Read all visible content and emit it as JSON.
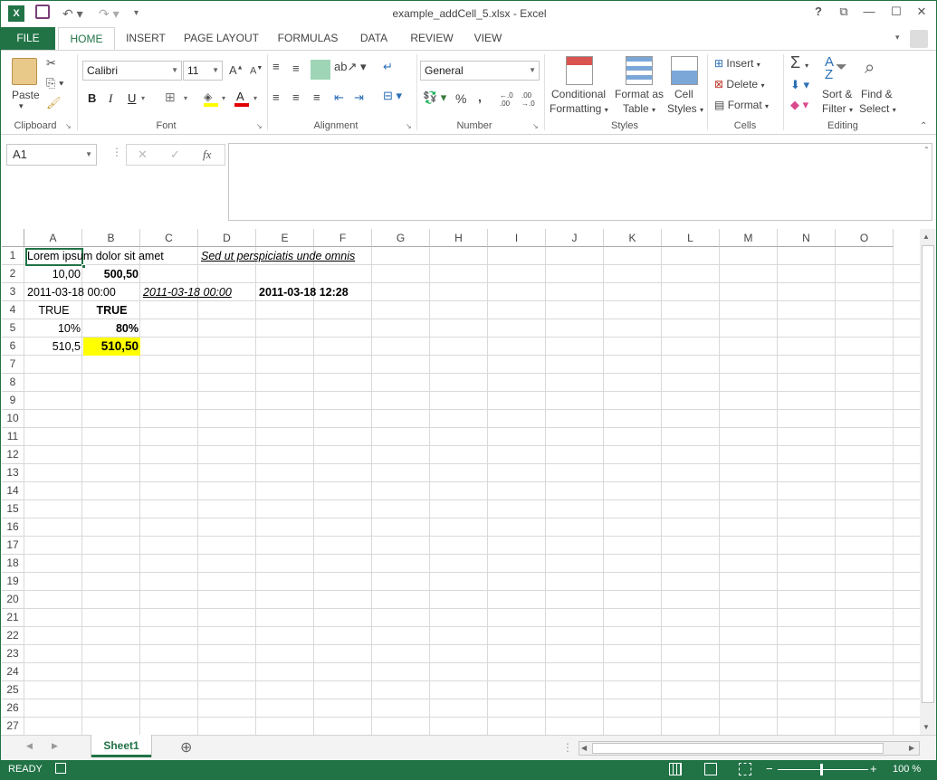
{
  "window": {
    "title": "example_addCell_5.xlsx - Excel",
    "help": "?",
    "restore_ribbon": "⧉",
    "minimize": "—",
    "maximize": "☐",
    "close": "✕"
  },
  "qat": {
    "excel_icon": "excel-logo-icon",
    "save": "save-icon",
    "undo": "undo-icon",
    "redo": "redo-icon",
    "customize": "customize-icon"
  },
  "tabs": [
    "FILE",
    "HOME",
    "INSERT",
    "PAGE LAYOUT",
    "FORMULAS",
    "DATA",
    "REVIEW",
    "VIEW"
  ],
  "ribbon": {
    "clipboard": {
      "label": "Clipboard",
      "paste": "Paste"
    },
    "font": {
      "label": "Font",
      "name": "Calibri",
      "size": "11",
      "bold": "B",
      "italic": "I",
      "underline": "U",
      "grow": "A",
      "shrink": "A",
      "font_color": "A"
    },
    "alignment": {
      "label": "Alignment"
    },
    "number": {
      "label": "Number",
      "format": "General",
      "percent": "%",
      "comma": ",",
      "inc_decimal": "←.0 .00",
      "dec_decimal": ".00 →.0"
    },
    "styles": {
      "label": "Styles",
      "conditional_1": "Conditional",
      "conditional_2": "Formatting",
      "format_table_1": "Format as",
      "format_table_2": "Table",
      "cell_styles_1": "Cell",
      "cell_styles_2": "Styles"
    },
    "cells": {
      "label": "Cells",
      "insert": "Insert",
      "delete": "Delete",
      "format": "Format"
    },
    "editing": {
      "label": "Editing",
      "sum": "Σ",
      "sort_1": "Sort &",
      "sort_2": "Filter",
      "find_1": "Find &",
      "find_2": "Select"
    }
  },
  "formula_bar": {
    "name_box": "A1",
    "cancel": "✕",
    "enter": "✓",
    "fx": "fx",
    "value": ""
  },
  "columns": [
    "A",
    "B",
    "C",
    "D",
    "E",
    "F",
    "G",
    "H",
    "I",
    "J",
    "K",
    "L",
    "M",
    "N",
    "O"
  ],
  "rows": [
    "1",
    "2",
    "3",
    "4",
    "5",
    "6",
    "7",
    "8",
    "9",
    "10",
    "11",
    "12",
    "13",
    "14",
    "15",
    "16",
    "17",
    "18",
    "19",
    "20",
    "21",
    "22",
    "23",
    "24",
    "25",
    "26",
    "27"
  ],
  "cells": {
    "A1": "Lorem ipsum dolor sit amet",
    "D1": "Sed ut perspiciatis unde omnis",
    "A2": "10,00",
    "B2": "500,50",
    "A3": "2011-03-18 00:00",
    "C3": "2011-03-18 00:00",
    "E3": "2011-03-18 12:28",
    "A4": "TRUE",
    "B4": "TRUE",
    "A5": "10%",
    "B5": "80%",
    "A6": "510,5",
    "B6": "510,50"
  },
  "colors": {
    "accent": "#217346",
    "highlight": "#ffff00"
  },
  "sheets": {
    "active": "Sheet1",
    "add": "⊕"
  },
  "status": {
    "mode": "READY",
    "zoom": "100 %",
    "minus": "−",
    "plus": "+"
  }
}
